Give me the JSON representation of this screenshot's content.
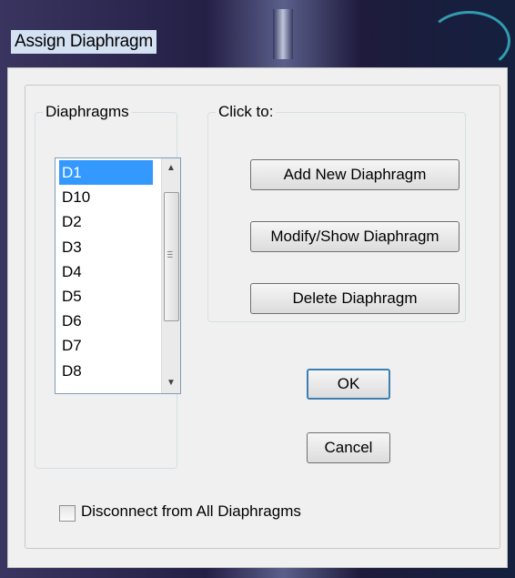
{
  "window": {
    "title": "Assign Diaphragm"
  },
  "diaphragms": {
    "group_label": "Diaphragms",
    "items": [
      "D1",
      "D10",
      "D2",
      "D3",
      "D4",
      "D5",
      "D6",
      "D7",
      "D8"
    ],
    "selected": "D1"
  },
  "actions": {
    "group_label": "Click to:",
    "add_label": "Add New Diaphragm",
    "modify_label": "Modify/Show Diaphragm",
    "delete_label": "Delete Diaphragm"
  },
  "buttons": {
    "ok_label": "OK",
    "cancel_label": "Cancel"
  },
  "disconnect": {
    "label": "Disconnect from All Diaphragms",
    "checked": false
  }
}
